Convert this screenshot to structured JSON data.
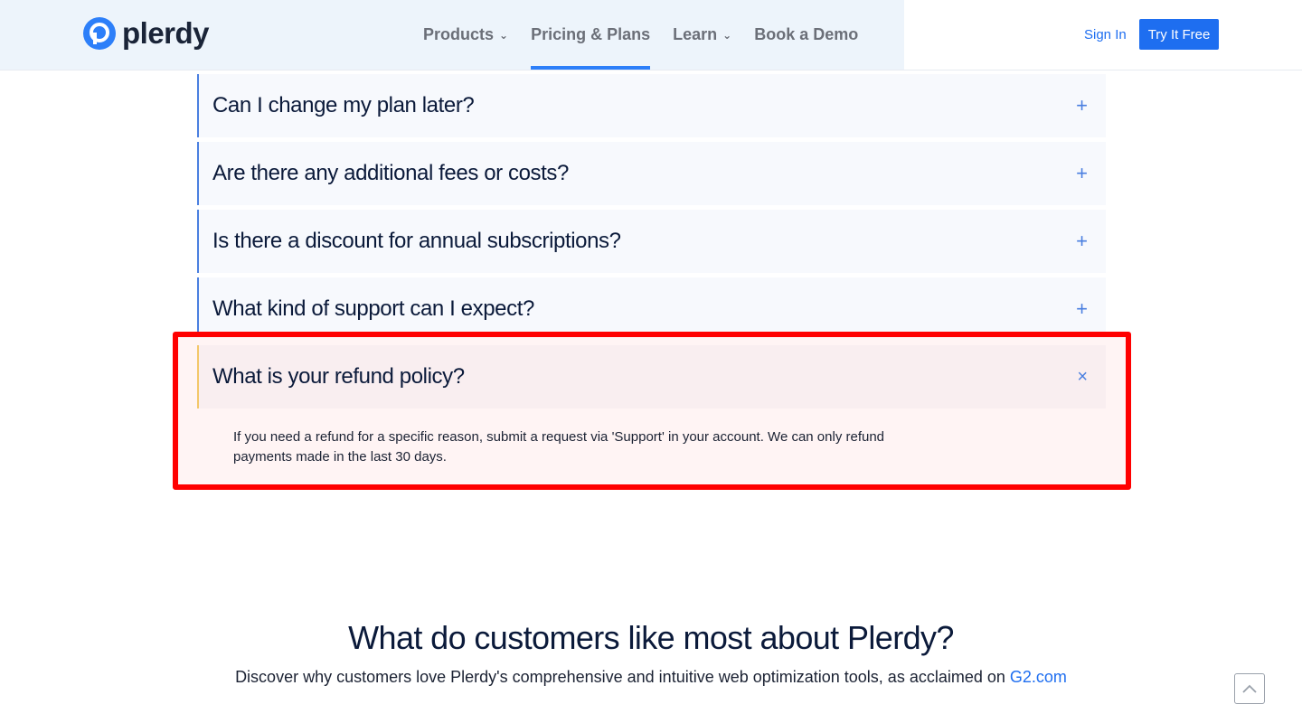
{
  "header": {
    "logo_text": "plerdy",
    "nav": [
      {
        "label": "Products",
        "has_dropdown": true
      },
      {
        "label": "Pricing & Plans",
        "active": true
      },
      {
        "label": "Learn",
        "has_dropdown": true
      },
      {
        "label": "Book a Demo"
      }
    ],
    "sign_in": "Sign In",
    "try_free": "Try It Free"
  },
  "faq": [
    {
      "question": "Can I change my plan later?",
      "toggle": "+"
    },
    {
      "question": "Are there any additional fees or costs?",
      "toggle": "+"
    },
    {
      "question": "Is there a discount for annual subscriptions?",
      "toggle": "+"
    },
    {
      "question": "What kind of support can I expect?",
      "toggle": "+"
    },
    {
      "question": "What is your refund policy?",
      "toggle": "×",
      "open": true,
      "answer": "If you need a refund for a specific reason, submit a request via 'Support' in your account. We can only refund payments made in the last 30 days."
    }
  ],
  "customers": {
    "title": "What do customers like most about Plerdy?",
    "subtitle": "Discover why customers love Plerdy's comprehensive and intuitive web optimization tools, as acclaimed on",
    "link": "G2.com"
  },
  "colors": {
    "accent": "#1e6ef0",
    "highlight": "#ff0000",
    "faq_border": "#4a7fe0",
    "open_border": "#f3c76a"
  },
  "icons": {
    "scroll_top": "chevron-up-icon",
    "dropdown": "chevron-down-icon"
  }
}
